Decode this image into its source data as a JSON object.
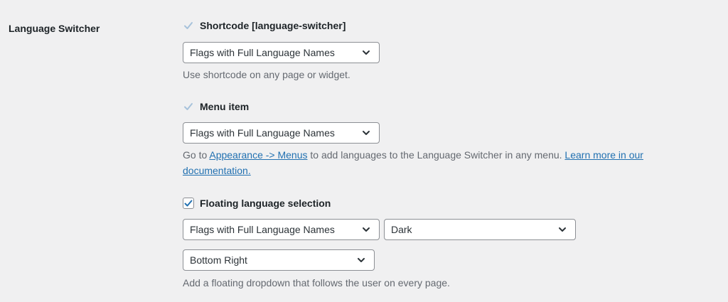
{
  "section_label": "Language Switcher",
  "shortcode": {
    "label": "Shortcode [language-switcher]",
    "checked": true,
    "select_value": "Flags with Full Language Names",
    "description": "Use shortcode on any page or widget."
  },
  "menu_item": {
    "label": "Menu item",
    "checked": true,
    "select_value": "Flags with Full Language Names",
    "desc_prefix": "Go to ",
    "desc_link1": "Appearance -> Menus",
    "desc_middle": " to add languages to the Language Switcher in any menu. ",
    "desc_link2": "Learn more in our documentation."
  },
  "floating": {
    "label": "Floating language selection",
    "checked": true,
    "select_style_value": "Flags with Full Language Names",
    "select_theme_value": "Dark",
    "select_position_value": "Bottom Right",
    "description": "Add a floating dropdown that follows the user on every page."
  },
  "colors": {
    "background": "#f0f0f1",
    "link": "#2271b1",
    "checkmark_disabled": "#a7c2db",
    "checkmark_active": "#2271b1"
  },
  "icons": {
    "checkmark": "checkmark-icon",
    "dropdown": "chevron-down-icon"
  }
}
